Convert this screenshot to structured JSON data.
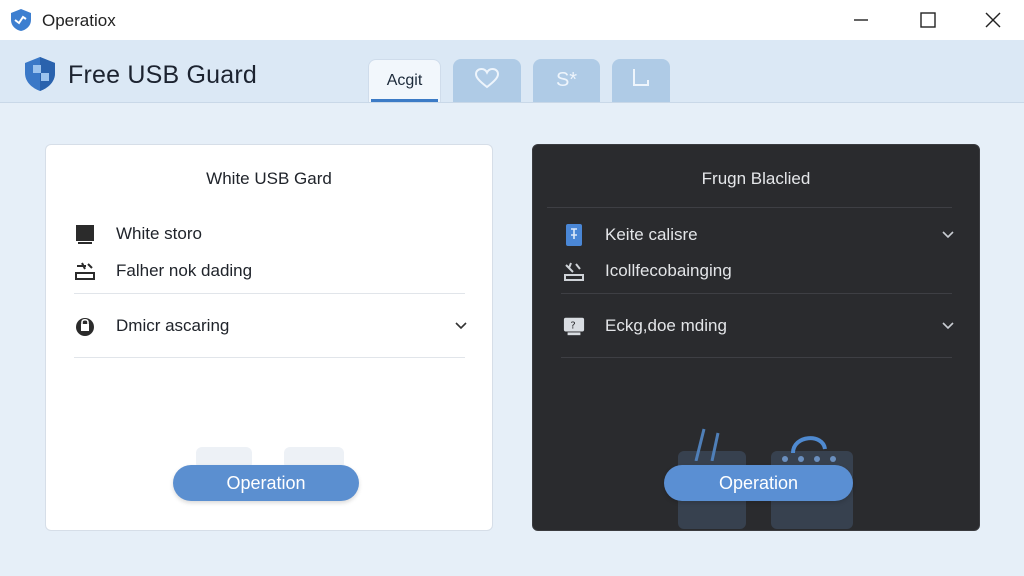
{
  "window": {
    "title": "Operatiox",
    "controls": [
      "minimize-icon",
      "maximize-icon",
      "close-icon"
    ]
  },
  "header": {
    "brand": "Free USB Guard",
    "tabs": [
      {
        "label": "Acgit",
        "active": true
      },
      {
        "icon": "heart-icon",
        "active": false
      },
      {
        "label": "S*",
        "active": false
      },
      {
        "icon": "corner-bracket-icon",
        "active": false
      }
    ]
  },
  "left_panel": {
    "title": "White USB Gard",
    "items": [
      {
        "label": "White storo",
        "icon": "monitor-square-icon"
      },
      {
        "label": "Falher nok dading",
        "icon": "usb-tool-icon"
      },
      {
        "label": "Dmicr ascaring",
        "icon": "lock-icon",
        "expandable": true
      }
    ],
    "button": "Operation"
  },
  "right_panel": {
    "title": "Frugn Blaclied",
    "items": [
      {
        "label": "Keite calisre",
        "icon": "usb-drive-icon",
        "expandable": true
      },
      {
        "label": "Icollfecobainging",
        "icon": "usb-tool-icon"
      },
      {
        "label": "Eckg,doe mding",
        "icon": "device-question-icon",
        "expandable": true
      }
    ],
    "button": "Operation"
  },
  "colors": {
    "accent": "#5b8fd0",
    "header_bg": "#dbe8f5",
    "dark_panel": "#2a2b2e"
  }
}
